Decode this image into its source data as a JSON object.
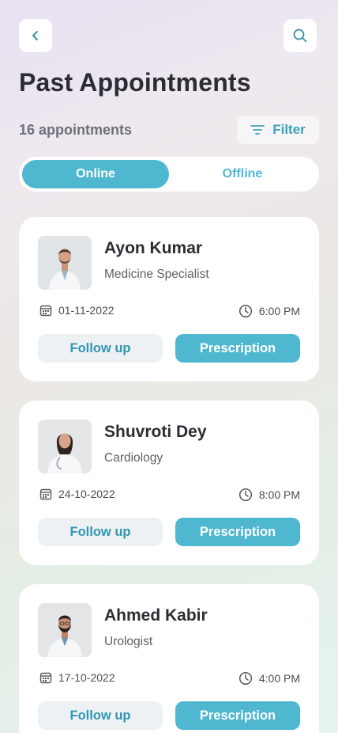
{
  "header": {
    "title": "Past Appointments",
    "count_text": "16 appointments",
    "filter_label": "Filter"
  },
  "tabs": [
    {
      "label": "Online",
      "active": true
    },
    {
      "label": "Offline",
      "active": false
    }
  ],
  "appointments": [
    {
      "name": "Ayon Kumar",
      "specialty": "Medicine Specialist",
      "date": "01-11-2022",
      "time": "6:00 PM",
      "follow_label": "Follow up",
      "prescription_label": "Prescription"
    },
    {
      "name": "Shuvroti Dey",
      "specialty": "Cardiology",
      "date": "24-10-2022",
      "time": "8:00 PM",
      "follow_label": "Follow up",
      "prescription_label": "Prescription"
    },
    {
      "name": "Ahmed Kabir",
      "specialty": "Urologist",
      "date": "17-10-2022",
      "time": "4:00 PM",
      "follow_label": "Follow up",
      "prescription_label": "Prescription"
    }
  ],
  "icons": [
    "back-arrow-icon",
    "search-icon",
    "filter-icon",
    "calendar-icon",
    "clock-icon"
  ],
  "colors": {
    "accent": "#4fb8d0",
    "accent_text": "#3196b2",
    "title": "#2b2d33",
    "muted": "#6e7077"
  }
}
